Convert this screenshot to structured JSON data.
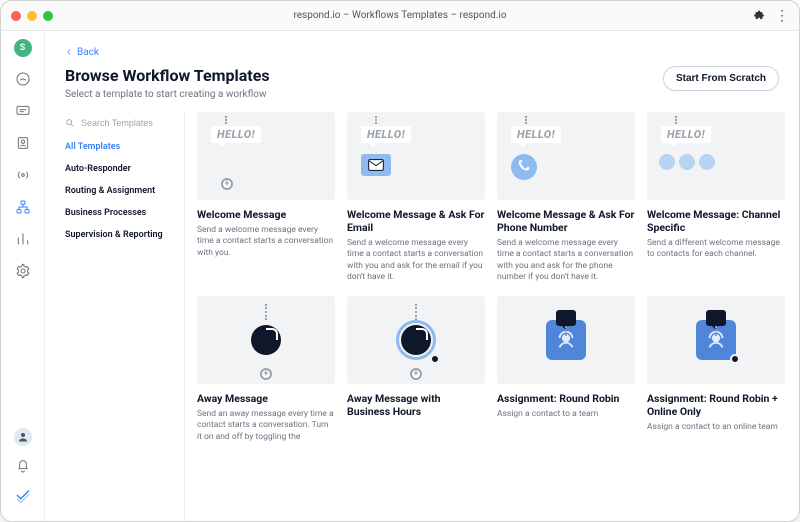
{
  "window": {
    "title": "respond.io – Workflows Templates – respond.io"
  },
  "rail": {
    "avatar_initial": "S",
    "icons": [
      {
        "name": "dashboard-icon"
      },
      {
        "name": "messages-icon"
      },
      {
        "name": "contacts-icon"
      },
      {
        "name": "broadcast-icon"
      },
      {
        "name": "workflows-icon",
        "active": true
      },
      {
        "name": "reports-icon"
      },
      {
        "name": "settings-icon"
      }
    ]
  },
  "header": {
    "back_label": "Back",
    "title": "Browse Workflow Templates",
    "subtitle": "Select a template to start creating a workflow",
    "scratch_button": "Start From Scratch"
  },
  "search": {
    "placeholder": "Search Templates"
  },
  "categories": [
    {
      "label": "All Templates",
      "active": true
    },
    {
      "label": "Auto-Responder"
    },
    {
      "label": "Routing & Assignment"
    },
    {
      "label": "Business Processes"
    },
    {
      "label": "Supervision & Reporting"
    }
  ],
  "hello_badge": "HELLO!",
  "templates": [
    {
      "style": "hello",
      "variant": "plain",
      "title": "Welcome Message",
      "desc": "Send a welcome message every time a contact starts a conversation with you."
    },
    {
      "style": "hello",
      "variant": "email",
      "title": "Welcome Message & Ask For Email",
      "desc": "Send a welcome message every time a contact starts a conversation with you and ask for the email if you don't have it."
    },
    {
      "style": "hello",
      "variant": "phone",
      "title": "Welcome Message & Ask For Phone Number",
      "desc": "Send a welcome message every time a contact starts a conversation with you and ask for the phone number if you don't have it."
    },
    {
      "style": "hello",
      "variant": "channels",
      "title": "Welcome Message: Channel Specific",
      "desc": "Send a different welcome message to contacts for each channel."
    },
    {
      "style": "away",
      "variant": "dark",
      "title": "Away Message",
      "desc": "Send an away message every time a contact starts a conversation. Turn it on and off by toggling the"
    },
    {
      "style": "away",
      "variant": "blue",
      "title": "Away Message with Business Hours",
      "desc": ""
    },
    {
      "style": "assign",
      "variant": "basic",
      "title": "Assignment: Round Robin",
      "desc": "Assign a contact to a team"
    },
    {
      "style": "assign",
      "variant": "online",
      "title": "Assignment: Round Robin + Online Only",
      "desc": "Assign a contact to an online team"
    }
  ]
}
